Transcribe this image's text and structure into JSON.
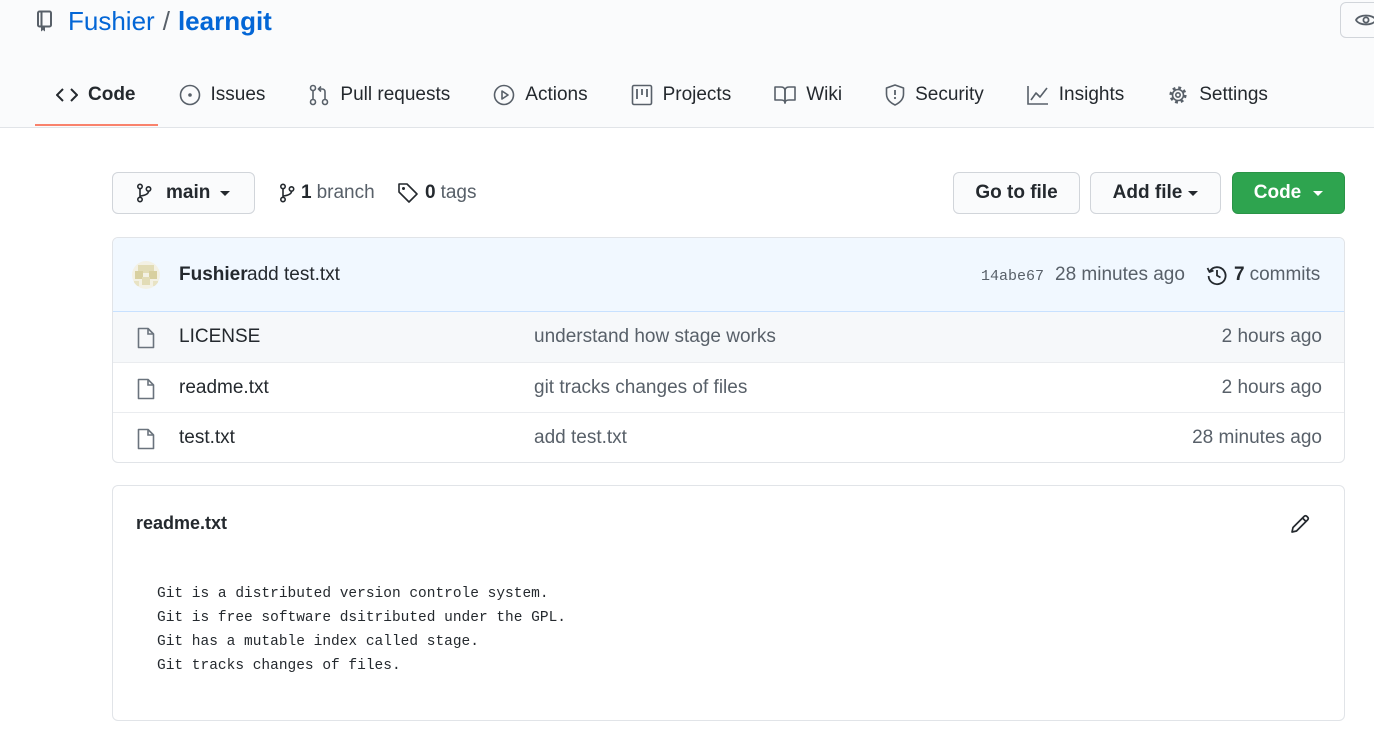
{
  "repo": {
    "owner": "Fushier",
    "separator": "/",
    "name": "learngit"
  },
  "tabs": [
    {
      "label": "Code",
      "icon": "code-icon",
      "selected": true
    },
    {
      "label": "Issues",
      "icon": "issue-icon"
    },
    {
      "label": "Pull requests",
      "icon": "pull-request-icon"
    },
    {
      "label": "Actions",
      "icon": "play-icon"
    },
    {
      "label": "Projects",
      "icon": "project-icon"
    },
    {
      "label": "Wiki",
      "icon": "book-icon"
    },
    {
      "label": "Security",
      "icon": "shield-icon"
    },
    {
      "label": "Insights",
      "icon": "graph-icon"
    },
    {
      "label": "Settings",
      "icon": "gear-icon"
    }
  ],
  "toolbar": {
    "branch": "main",
    "branches_count": "1",
    "branches_label": "branch",
    "tags_count": "0",
    "tags_label": "tags",
    "go_to_file": "Go to file",
    "add_file": "Add file",
    "code": "Code"
  },
  "latest_commit": {
    "author": "Fushier",
    "message": "add test.txt",
    "sha": "14abe67",
    "time": "28 minutes ago",
    "commits_count": "7",
    "commits_label": "commits"
  },
  "files": [
    {
      "name": "LICENSE",
      "message": "understand how stage works",
      "age": "2 hours ago"
    },
    {
      "name": "readme.txt",
      "message": "git tracks changes of files",
      "age": "2 hours ago"
    },
    {
      "name": "test.txt",
      "message": "add test.txt",
      "age": "28 minutes ago"
    }
  ],
  "readme": {
    "title": "readme.txt",
    "content": "Git is a distributed version controle system.\nGit is free software dsitributed under the GPL.\nGit has a mutable index called stage.\nGit tracks changes of files."
  },
  "colors": {
    "link": "#0366d6",
    "primary_button": "#2ea44f",
    "selected_tab_underline": "#f9826c",
    "commit_bar_bg": "#f1f8ff"
  }
}
